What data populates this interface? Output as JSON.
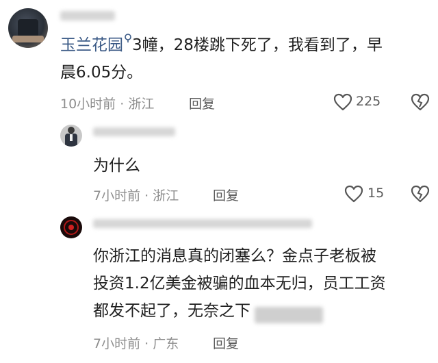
{
  "comments": [
    {
      "mention": "玉兰花园",
      "text_line1": "3幢，28楼跳下死了，我看到了，早",
      "text_line2": "晨6.05分。",
      "time": "10小时前",
      "location": "浙江",
      "reply_label": "回复",
      "likes": "225"
    },
    {
      "text": "为什么",
      "time": "7小时前",
      "location": "浙江",
      "reply_label": "回复",
      "likes": "15"
    },
    {
      "text_line1": "你浙江的消息真的闭塞么？金点子老板被",
      "text_line2": "投资1.2亿美金被骗的血本无归，员工工资",
      "text_line3": "都发不起了，无奈之下",
      "time": "7小时前",
      "location": "广东",
      "reply_label": "回复"
    }
  ],
  "separator": "·",
  "icons": {
    "like": "heart-outline-icon",
    "dislike": "broken-heart-icon",
    "location": "location-pin-icon"
  },
  "colors": {
    "mention": "#3b5a86",
    "meta": "#8e8e8e",
    "text": "#1f1f1f"
  }
}
